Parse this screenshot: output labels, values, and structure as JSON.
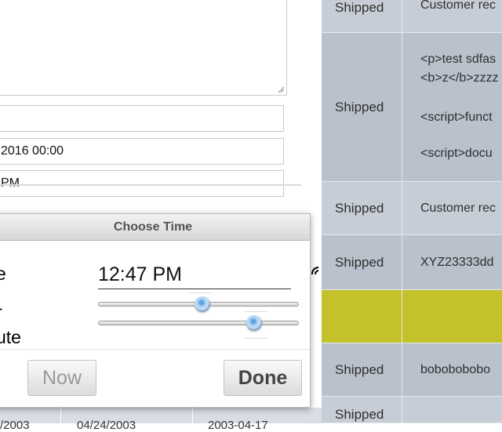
{
  "table": {
    "rows": [
      {
        "status": "Shipped",
        "notes": [
          "Customer rec"
        ]
      },
      {
        "status": "Shipped",
        "notes": [
          "<p>test sdfas",
          "<b>z</b>zzzz",
          "<script>funct",
          "<script>docu"
        ]
      },
      {
        "status": "Shipped",
        "notes": [
          "Customer rec"
        ]
      },
      {
        "status": "Shipped",
        "notes": [
          "XYZ23333dd"
        ]
      },
      {
        "status": "",
        "notes": [
          ""
        ]
      },
      {
        "status": "Shipped",
        "notes": [
          "bobobobobo"
        ]
      },
      {
        "status": "Shipped",
        "notes": [
          ""
        ]
      }
    ]
  },
  "form": {
    "field1_value": "",
    "field2_value": "2016 00:00",
    "field3_value": "PM"
  },
  "left_table": {
    "row_cells": [
      "/2003",
      "04/24/2003",
      "2003-04-17"
    ]
  },
  "time_dialog": {
    "title": "Choose Time",
    "time_label": "e",
    "hour_label": "r",
    "minute_label": "ute",
    "time_value": "12:47 PM",
    "hour_fraction": 0.52,
    "minute_fraction": 0.78,
    "now_label": "Now",
    "done_label": "Done"
  }
}
